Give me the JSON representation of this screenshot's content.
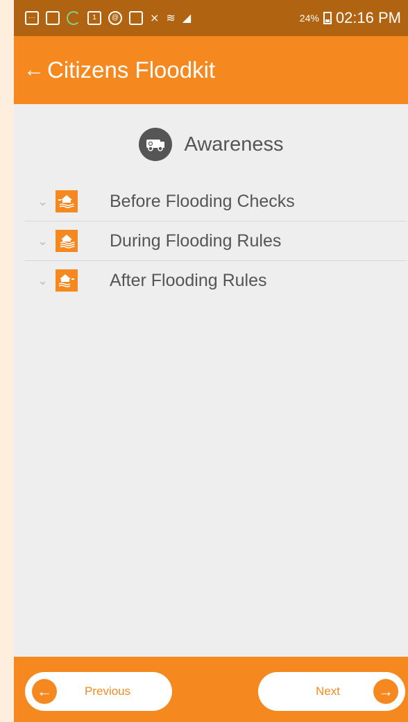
{
  "status_bar": {
    "icons": [
      "message-icon",
      "image-icon",
      "sync-icon",
      "calendar-icon",
      "app-icon",
      "photo-icon",
      "mute-icon",
      "wifi-icon",
      "signal-icon"
    ],
    "battery": "24%",
    "time": "02:16 PM"
  },
  "app_bar": {
    "back_icon": "←",
    "title": "Citizens Floodkit"
  },
  "section": {
    "icon": "truck-icon",
    "title": "Awareness"
  },
  "items": [
    {
      "label": "Before Flooding Checks",
      "icon": "house-flood-before-icon"
    },
    {
      "label": "During Flooding Rules",
      "icon": "house-flood-during-icon"
    },
    {
      "label": "After Flooding Rules",
      "icon": "house-flood-after-icon"
    }
  ],
  "footer": {
    "previous_label": "Previous",
    "next_label": "Next"
  },
  "colors": {
    "accent": "#f5881f",
    "status_bar": "#b06412",
    "background": "#eeeeee",
    "text": "#555555"
  }
}
